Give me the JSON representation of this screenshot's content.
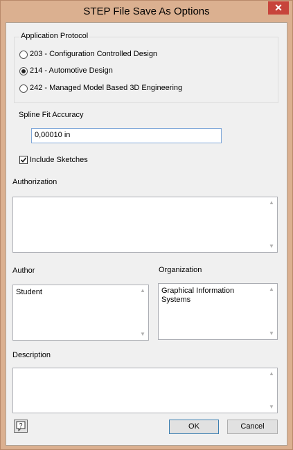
{
  "window": {
    "title": "STEP File Save As Options",
    "close_glyph": "✕"
  },
  "protocol": {
    "label": "Application Protocol",
    "options": [
      {
        "label": "203 - Configuration Controlled Design",
        "selected": false
      },
      {
        "label": "214 - Automotive Design",
        "selected": true
      },
      {
        "label": "242 - Managed Model Based 3D Engineering",
        "selected": false
      }
    ]
  },
  "spline": {
    "label": "Spline Fit Accuracy",
    "value": "0,00010 in"
  },
  "sketches": {
    "label": "Include Sketches",
    "checked": true
  },
  "authorization": {
    "label": "Authorization",
    "value": ""
  },
  "author": {
    "label": "Author",
    "value": "Student"
  },
  "organization": {
    "label": "Organization",
    "value": "Graphical Information\nSystems"
  },
  "description": {
    "label": "Description",
    "value": ""
  },
  "buttons": {
    "ok": "OK",
    "cancel": "Cancel"
  },
  "icons": {
    "help": "help-icon",
    "scroll_up": "▲",
    "scroll_down": "▼"
  }
}
